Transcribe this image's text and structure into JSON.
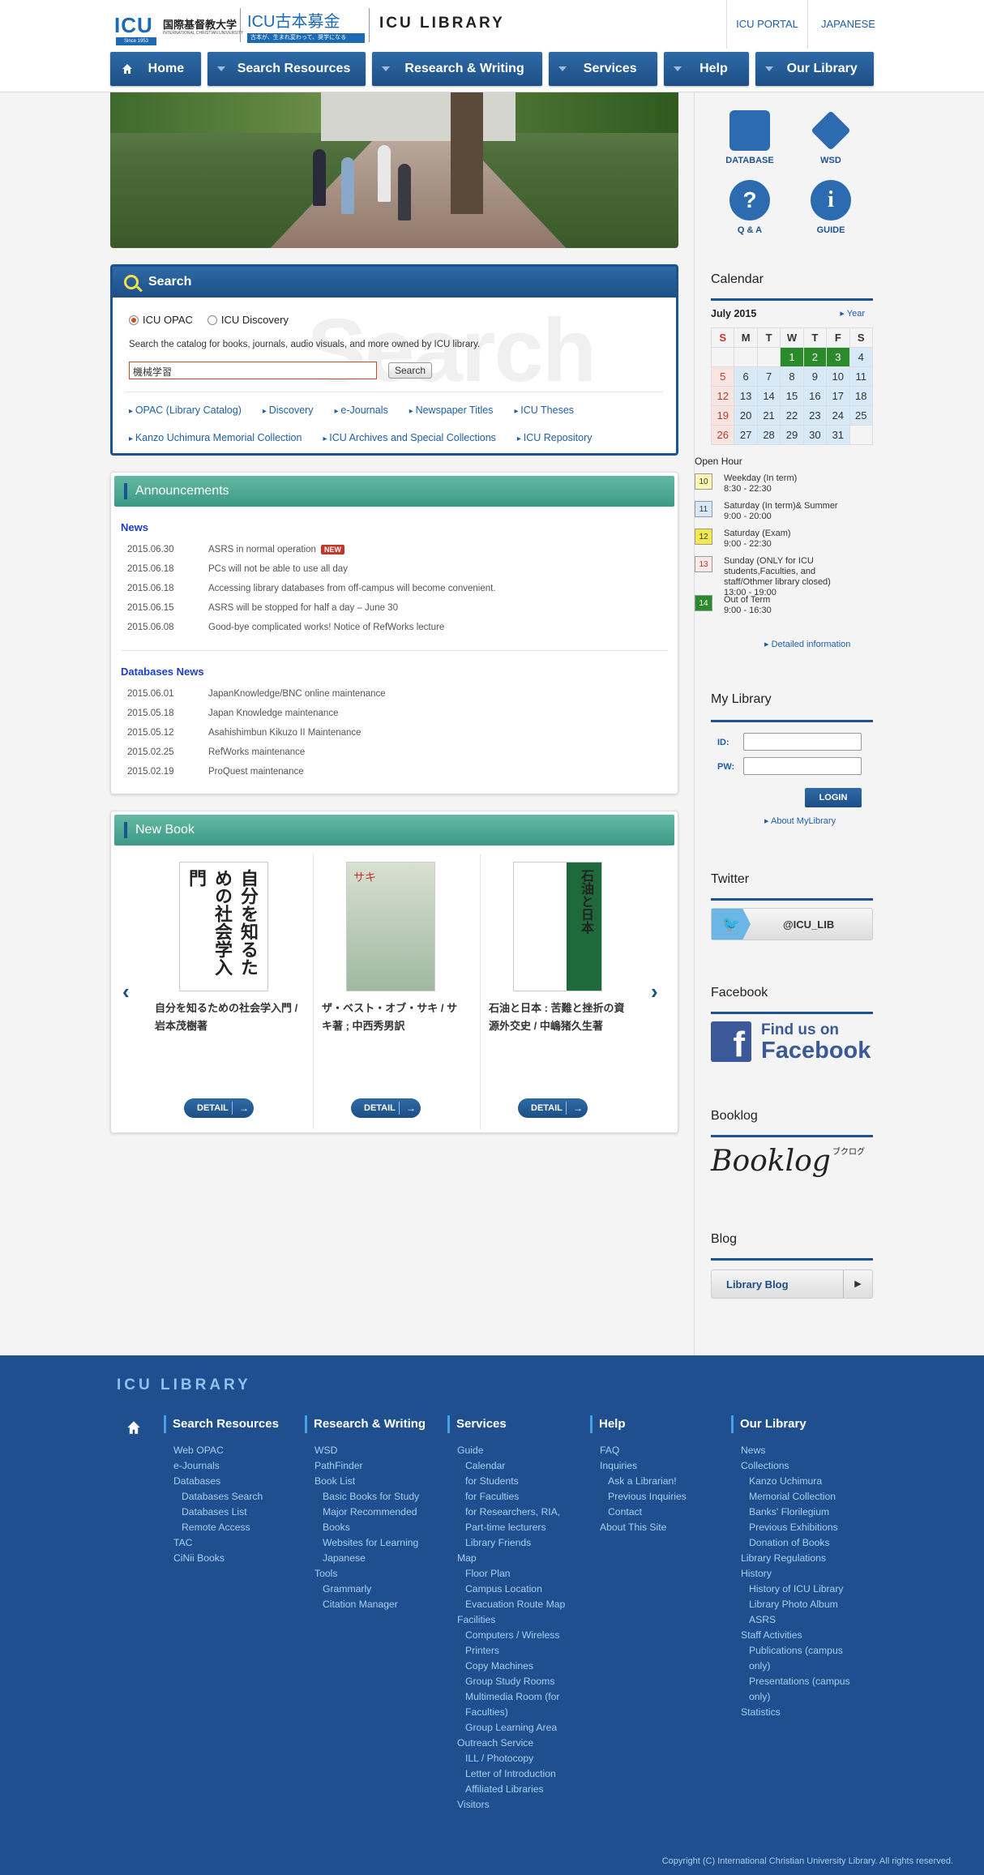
{
  "header": {
    "logo_mark": "ICU",
    "logo_jp": "国際基督教大学",
    "logo_en": "INTERNATIONAL CHRISTIAN UNIVERSITY",
    "logo_since": "Since 1953",
    "fund_title": "ICU古本募金",
    "fund_sub": "古本が、生まれ変わって、奨学になる",
    "library_title": "ICU LIBRARY",
    "top_links": [
      "ICU PORTAL",
      "JAPANESE"
    ]
  },
  "nav": {
    "home": "Home",
    "items": [
      "Search Resources",
      "Research & Writing",
      "Services",
      "Help",
      "Our Library"
    ]
  },
  "search": {
    "title": "Search",
    "watermark": "Search",
    "radio_opac": "ICU OPAC",
    "radio_discovery": "ICU Discovery",
    "description": "Search the catalog for books, journals, audio visuals, and more owned by ICU library.",
    "query": "機械学習",
    "button": "Search",
    "links_row1": [
      "OPAC (Library Catalog)",
      "Discovery",
      "e-Journals",
      "Newspaper Titles",
      "ICU Theses"
    ],
    "links_row2": [
      "Kanzo Uchimura Memorial Collection",
      "ICU Archives and Special Collections",
      "ICU Repository"
    ]
  },
  "announcements": {
    "title": "Announcements",
    "news_title": "News",
    "new_badge": "NEW",
    "news": [
      {
        "date": "2015.06.30",
        "text": "ASRS in normal operation"
      },
      {
        "date": "2015.06.18",
        "text": "PCs will not be able to use all day"
      },
      {
        "date": "2015.06.18",
        "text": "Accessing library databases from off-campus will become convenient."
      },
      {
        "date": "2015.06.15",
        "text": "ASRS will be stopped for half a day – June 30"
      },
      {
        "date": "2015.06.08",
        "text": "Good-bye complicated works! Notice of RefWorks lecture"
      }
    ],
    "db_title": "Databases News",
    "db_news": [
      {
        "date": "2015.06.01",
        "text": "JapanKnowledge/BNC online maintenance"
      },
      {
        "date": "2015.05.18",
        "text": "Japan Knowledge maintenance"
      },
      {
        "date": "2015.05.12",
        "text": "Asahishimbun Kikuzo II Maintenance"
      },
      {
        "date": "2015.02.25",
        "text": "RefWorks maintenance"
      },
      {
        "date": "2015.02.19",
        "text": "ProQuest maintenance"
      }
    ]
  },
  "new_book": {
    "title": "New Book",
    "detail_label": "DETAIL",
    "books": [
      {
        "title": "自分を知るための社会学入門 / 岩本茂樹著",
        "cover": "自分を知るための社会学入門"
      },
      {
        "title": "ザ・ベスト・オブ・サキ / サキ著 ; 中西秀男訳",
        "cover": "サキ"
      },
      {
        "title": "石油と日本 : 苦難と挫折の資源外交史 / 中嶋猪久生著",
        "cover": "石油と日本"
      }
    ]
  },
  "quick": [
    "DATABASE",
    "WSD",
    "Q & A",
    "GUIDE"
  ],
  "calendar": {
    "title": "Calendar",
    "month": "July 2015",
    "year_link": "Year",
    "days": [
      "S",
      "M",
      "T",
      "W",
      "T",
      "F",
      "S"
    ],
    "weeks": [
      [
        "",
        "",
        "",
        "1",
        "2",
        "3",
        "4"
      ],
      [
        "5",
        "6",
        "7",
        "8",
        "9",
        "10",
        "11"
      ],
      [
        "12",
        "13",
        "14",
        "15",
        "16",
        "17",
        "18"
      ],
      [
        "19",
        "20",
        "21",
        "22",
        "23",
        "24",
        "25"
      ],
      [
        "26",
        "27",
        "28",
        "29",
        "30",
        "31",
        ""
      ]
    ],
    "colors": {
      "green": "#2b8a2b",
      "blue": "#d7e8f6",
      "red": "#c0392b"
    }
  },
  "open_hour": {
    "title": "Open Hour",
    "rows": [
      {
        "badge": "10",
        "text": "Weekday (In term)\n8:30 - 22:30"
      },
      {
        "badge": "11",
        "text": "Saturday (In term)& Summer\n9:00 - 20:00"
      },
      {
        "badge": "12",
        "text": "Saturday (Exam)\n9:00 - 22:30"
      },
      {
        "badge": "13",
        "text": "Sunday (ONLY for ICU students,Faculties, and staff/Othmer library closed)\n13:00 - 19:00"
      },
      {
        "badge": "14",
        "text": "Out of Term\n9:00 - 16:30"
      }
    ],
    "detail_link": "Detailed information"
  },
  "mylibrary": {
    "title": "My Library",
    "id_label": "ID:",
    "pw_label": "PW:",
    "login": "LOGIN",
    "about": "About MyLibrary"
  },
  "twitter": {
    "title": "Twitter",
    "handle": "@ICU_LIB"
  },
  "facebook": {
    "title": "Facebook",
    "line1": "Find us on",
    "line2": "Facebook"
  },
  "booklog": {
    "title": "Booklog",
    "logo": "Booklog",
    "kana": "ブクログ"
  },
  "blog": {
    "title": "Blog",
    "button": "Library Blog"
  },
  "footer": {
    "title": "ICU LIBRARY",
    "copyright": "Copyright (C) International Christian University Library. All rights reserved.",
    "cols": [
      {
        "h": "Search Resources",
        "items": [
          [
            "Web OPAC",
            0
          ],
          [
            "e-Journals",
            0
          ],
          [
            "Databases",
            0
          ],
          [
            "Databases Search",
            1
          ],
          [
            "Databases List",
            1
          ],
          [
            "Remote Access",
            1
          ],
          [
            "TAC",
            0
          ],
          [
            "CiNii Books",
            0
          ]
        ]
      },
      {
        "h": "Research & Writing",
        "items": [
          [
            "WSD",
            0
          ],
          [
            "PathFinder",
            0
          ],
          [
            "Book List",
            0
          ],
          [
            "Basic Books for Study",
            1
          ],
          [
            "Major Recommended Books",
            1
          ],
          [
            "Websites for Learning Japanese",
            1
          ],
          [
            "Tools",
            0
          ],
          [
            "Grammarly",
            1
          ],
          [
            "Citation Manager",
            1
          ]
        ]
      },
      {
        "h": "Services",
        "items": [
          [
            "Guide",
            0
          ],
          [
            "Calendar",
            1
          ],
          [
            "for Students",
            1
          ],
          [
            "for Faculties",
            1
          ],
          [
            "for Researchers, RIA, Part-time lecturers",
            1
          ],
          [
            "Library Friends",
            1
          ],
          [
            "Map",
            0
          ],
          [
            "Floor Plan",
            1
          ],
          [
            "Campus Location",
            1
          ],
          [
            "Evacuation Route Map",
            1
          ],
          [
            "Facilities",
            0
          ],
          [
            "Computers / Wireless Printers",
            1
          ],
          [
            "Copy Machines",
            1
          ],
          [
            "Group Study Rooms",
            1
          ],
          [
            "Multimedia Room (for Faculties)",
            1
          ],
          [
            "Group Learning Area",
            1
          ],
          [
            "Outreach Service",
            0
          ],
          [
            "ILL / Photocopy",
            1
          ],
          [
            "Letter of Introduction",
            1
          ],
          [
            "Affiliated Libraries",
            1
          ],
          [
            "Visitors",
            0
          ]
        ]
      },
      {
        "h": "Help",
        "items": [
          [
            "FAQ",
            0
          ],
          [
            "Inquiries",
            0
          ],
          [
            "Ask a Librarian!",
            1
          ],
          [
            "Previous Inquiries",
            1
          ],
          [
            "Contact",
            1
          ],
          [
            "About This Site",
            0
          ]
        ]
      },
      {
        "h": "Our Library",
        "items": [
          [
            "News",
            0
          ],
          [
            "Collections",
            0
          ],
          [
            "Kanzo Uchimura Memorial Collection",
            1
          ],
          [
            "Banks' Florilegium",
            1
          ],
          [
            "Previous Exhibitions",
            1
          ],
          [
            "Donation of Books",
            1
          ],
          [
            "Library Regulations",
            0
          ],
          [
            "History",
            0
          ],
          [
            "History of ICU Library",
            1
          ],
          [
            "Library Photo Album",
            1
          ],
          [
            "ASRS",
            1
          ],
          [
            "Staff Activities",
            0
          ],
          [
            "Publications (campus only)",
            1
          ],
          [
            "Presentations (campus only)",
            1
          ],
          [
            "Statistics",
            0
          ]
        ]
      }
    ]
  }
}
